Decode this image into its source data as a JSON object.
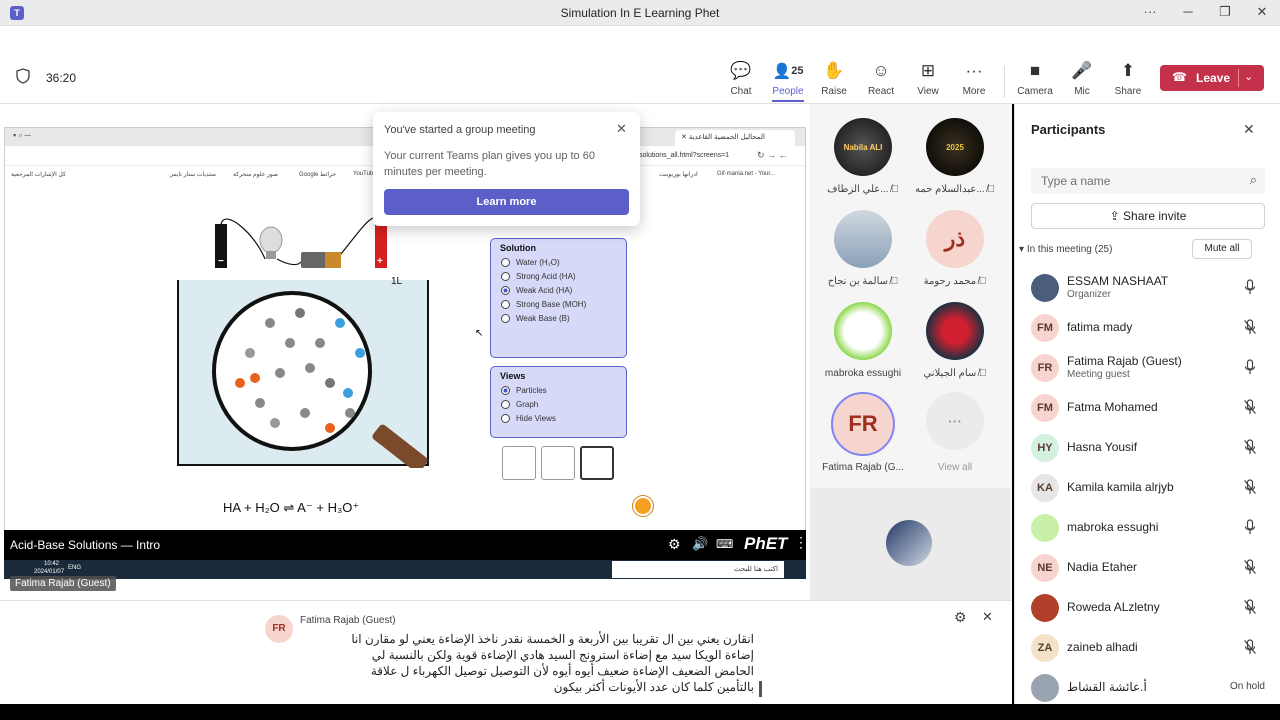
{
  "window": {
    "title": "Simulation In E Learning Phet"
  },
  "meeting": {
    "timer": "36:20"
  },
  "toolbar": {
    "chat": "Chat",
    "people": "People",
    "people_count": "25",
    "raise": "Raise",
    "react": "React",
    "view": "View",
    "more": "More",
    "camera": "Camera",
    "mic": "Mic",
    "share": "Share",
    "leave": "Leave"
  },
  "popup": {
    "title": "You've started a group meeting",
    "body": "Your current Teams plan gives you up to 60 minutes per meeting.",
    "button": "Learn more"
  },
  "browser": {
    "tab1": "المحاليل الحمضية القاعدية",
    "url": "solutions_all.html?screens=1",
    "bookmarks": [
      "كل الإشارات المرجعية",
      "منتديات ستار تايمز",
      "صور علوم متحركة",
      "Google خرائط",
      "YouTub",
      "ادراتها بوربوينت",
      "Gif-mania.net - Your..."
    ]
  },
  "sim": {
    "battery_minus": "−",
    "battery_plus": "+",
    "beaker_label": "1L",
    "solution_header": "Solution",
    "solutions": [
      "Water (H₂O)",
      "Strong Acid (HA)",
      "Weak Acid (HA)",
      "Strong Base (MOH)",
      "Weak Base (B)"
    ],
    "views_header": "Views",
    "views": [
      "Particles",
      "Graph",
      "Hide Views"
    ],
    "eq_ha": "HA",
    "eq_plus1": "+",
    "eq_h2o": "H₂O",
    "eq_arrow": "⇌",
    "eq_a": "A⁻",
    "eq_plus2": "+",
    "eq_h3o": "H₃O⁺",
    "footer_title": "Acid-Base Solutions — Intro",
    "phet": "PhET"
  },
  "taskbar": {
    "time": "10:42",
    "date": "2024/01/07",
    "lang": "ENG",
    "search": "اكتب هنا للبحث"
  },
  "presenter_label": "Fatima Rajab (Guest)",
  "gallery": [
    {
      "name": "علي الزطاف...",
      "initials": "Nabila ALI",
      "muted": true
    },
    {
      "name": "عبدالسلام حمه...",
      "initials": "2025",
      "muted": true
    },
    {
      "name": "سالمة بن نجاح",
      "initials": "",
      "muted": true
    },
    {
      "name": "محمد رحومة",
      "initials": "ذر",
      "muted": true
    },
    {
      "name": "mabroka essughi",
      "initials": "",
      "muted": false
    },
    {
      "name": "سام الجيلاني",
      "initials": "",
      "muted": true
    },
    {
      "name": "Fatima Rajab (G...",
      "initials": "FR",
      "muted": false
    },
    {
      "name": "View all",
      "initials": "···",
      "muted": false
    }
  ],
  "panel": {
    "title": "Participants",
    "search_placeholder": "Type a name",
    "share_invite": "Share invite",
    "section": "In this meeting (25)",
    "mute_all": "Mute all",
    "participants": [
      {
        "initials": "",
        "name": "ESSAM NASHAAT",
        "sub": "Organizer",
        "status": "mic",
        "color": "#4a5d7a"
      },
      {
        "initials": "FM",
        "name": "fatima mady",
        "sub": "",
        "status": "muted",
        "color": "#f6d5cf"
      },
      {
        "initials": "FR",
        "name": "Fatima Rajab (Guest)",
        "sub": "Meeting guest",
        "status": "mic",
        "color": "#f6d5cf"
      },
      {
        "initials": "FM",
        "name": "Fatma Mohamed",
        "sub": "",
        "status": "muted",
        "color": "#f6d5cf"
      },
      {
        "initials": "HY",
        "name": "Hasna Yousif",
        "sub": "",
        "status": "muted",
        "color": "#d4f0df"
      },
      {
        "initials": "KA",
        "name": "Kamila kamila alrjyb",
        "sub": "",
        "status": "muted",
        "color": "#e6e6e6"
      },
      {
        "initials": "",
        "name": "mabroka essughi",
        "sub": "",
        "status": "mic",
        "color": "#c8f0a8"
      },
      {
        "initials": "NE",
        "name": "Nadia Etaher",
        "sub": "",
        "status": "muted",
        "color": "#f6d5cf"
      },
      {
        "initials": "",
        "name": "Roweda ALzletny",
        "sub": "",
        "status": "muted",
        "color": "#b0402a"
      },
      {
        "initials": "ZA",
        "name": "zaineb alhadi",
        "sub": "",
        "status": "muted",
        "color": "#f3e2c8"
      },
      {
        "initials": "",
        "name": "أ.عائشة القشاط",
        "sub": "",
        "status": "On hold",
        "color": "#9aa4b0"
      }
    ]
  },
  "captions": {
    "speaker_initials": "FR",
    "speaker": "Fatima Rajab (Guest)",
    "lines": [
      "انقارن يعني بين ال تقريبا بين الأربعة و الخمسة نقدر ناخذ الإضاءة يعني لو مقارن انا",
      "إضاءة الويكا سيد مع إضاءة استرونج السيد هادي الإضاءة قوية ولكن بالنسبة لي",
      "الحامض الضعيف الإضاءة ضعيف أيوه أيوه لأن التوصيل توصيل الكهرباء ل علاقة",
      "بالتأمين كلما كان عدد الأيونات أكثر بيكون"
    ]
  },
  "colors": {
    "accent": "#5b5fc7",
    "leave": "#c4314b"
  }
}
